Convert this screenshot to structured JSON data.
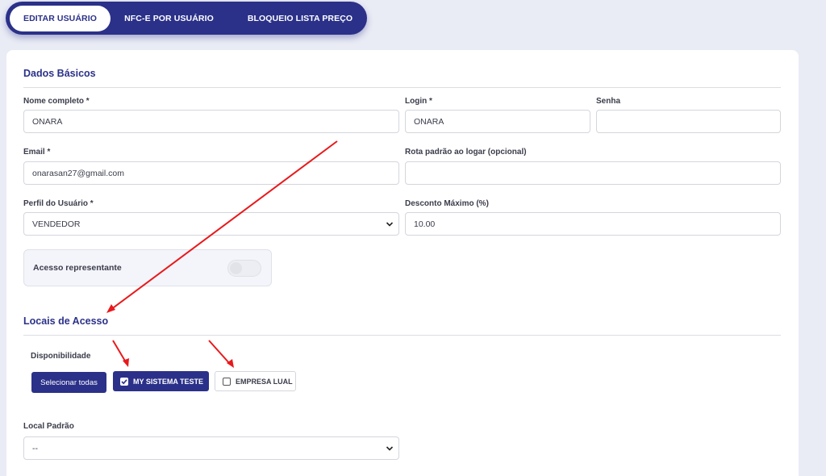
{
  "tabs": [
    {
      "label": "EDITAR USUÁRIO",
      "active": true
    },
    {
      "label": "NFC-E POR USUÁRIO",
      "active": false
    },
    {
      "label": "BLOQUEIO LISTA PREÇO",
      "active": false
    }
  ],
  "dados_basicos": {
    "title": "Dados Básicos",
    "nome": {
      "label": "Nome completo *",
      "value": "ONARA"
    },
    "login": {
      "label": "Login *",
      "value": "ONARA"
    },
    "senha": {
      "label": "Senha",
      "value": ""
    },
    "email": {
      "label": "Email *",
      "value": "onarasan27@gmail.com"
    },
    "rota": {
      "label": "Rota padrão ao logar (opcional)",
      "value": ""
    },
    "perfil": {
      "label": "Perfil do Usuário *",
      "value": "VENDEDOR"
    },
    "desconto": {
      "label": "Desconto Máximo (%)",
      "value": "10.00"
    },
    "acesso_representante": {
      "label": "Acesso representante",
      "enabled": false
    }
  },
  "locais": {
    "title": "Locais de Acesso",
    "disponibilidade_label": "Disponibilidade",
    "select_all_label": "Selecionar todas",
    "options": [
      {
        "label": "MY SISTEMA TESTE",
        "checked": true
      },
      {
        "label": "EMPRESA LUAL",
        "checked": false
      }
    ],
    "local_padrao": {
      "label": "Local Padrão",
      "value": "--"
    }
  },
  "colors": {
    "primary": "#2b3189",
    "annotation_arrow": "#e8191c",
    "background": "#e9ebf5"
  }
}
